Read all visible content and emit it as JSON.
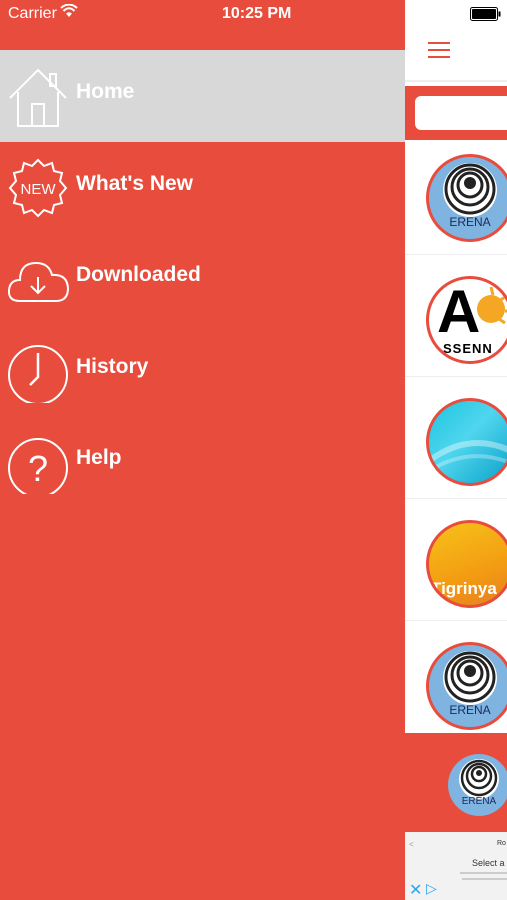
{
  "status_bar": {
    "carrier": "Carrier",
    "time": "10:25 PM"
  },
  "menu": {
    "items": [
      {
        "label": "Home",
        "icon": "home-icon"
      },
      {
        "label": "What's New",
        "icon": "new-badge-icon",
        "badge_text": "NEW"
      },
      {
        "label": "Downloaded",
        "icon": "cloud-download-icon"
      },
      {
        "label": "History",
        "icon": "clock-icon"
      },
      {
        "label": "Help",
        "icon": "help-icon",
        "glyph": "?"
      }
    ]
  },
  "stations": [
    {
      "name": "ERENA"
    },
    {
      "name": "ASSENNA"
    },
    {
      "name": ""
    },
    {
      "name": "Tigrinya"
    },
    {
      "name": "ERENA"
    }
  ],
  "station_labels": {
    "erena": "ERENA",
    "assenna_letter": "A",
    "assenna_text": "SSENN",
    "tigrinya": "Tigrinya"
  },
  "now_playing": {
    "name": "ERENA"
  },
  "ad": {
    "title": "Ro",
    "select_text": "Select a la"
  },
  "colors": {
    "accent": "#e84c3d",
    "menu_active": "#d8d8d8"
  }
}
